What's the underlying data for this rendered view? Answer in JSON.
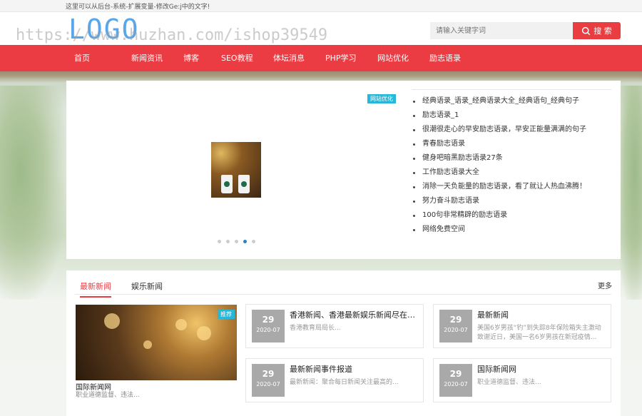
{
  "topbar": {
    "text": "这里可以从后台-系统-扩展变量-修改Ge:j中的文字!"
  },
  "header": {
    "logo": "LOGO",
    "watermark": "https://www.huzhan.com/ishop39549",
    "search": {
      "placeholder": "请输入关键字词",
      "button": "搜 索"
    }
  },
  "nav": {
    "items": [
      "首页",
      "新闻资讯",
      "博客",
      "SEO教程",
      "体坛消息",
      "PHP学习",
      "网站优化",
      "励志语录"
    ]
  },
  "slider": {
    "tag": "网站优化",
    "dots": 5,
    "active_dot": 4
  },
  "headlines": [
    "经典语录_语录_经典语录大全_经典语句_经典句子",
    "励志语录_1",
    "很潮很走心的早安励志语录，早安正能量满满的句子",
    "青春励志语录",
    "健身吧暗黑励志语录27条",
    "工作励志语录大全",
    "消除一天负能量的励志语录，看了就让人热血沸腾！",
    "努力奋斗励志语录",
    "100句非常精辟的励志语录",
    "网络免费空间"
  ],
  "news": {
    "tabs": [
      "最新新闻",
      "娱乐新闻"
    ],
    "more": "更多",
    "featured": {
      "badge": "推荐",
      "title": "国际新闻网",
      "desc": "职业道德监督、违法..."
    },
    "cards": [
      {
        "day": "29",
        "ym": "2020-07",
        "title": "香港新闻、香港最新娱乐新闻尽在香...",
        "summary": "香港教育局局长..."
      },
      {
        "day": "29",
        "ym": "2020-07",
        "title": "最新新闻",
        "summary": "美国6岁男孩“钓”到失踪8年保险箱失主激动致谢近日，美国一名6岁男孩在新冠疫情..."
      },
      {
        "day": "29",
        "ym": "2020-07",
        "title": "最新新闻事件报道",
        "summary": "最新新闻：聚合每日新闻关注最高的..."
      },
      {
        "day": "29",
        "ym": "2020-07",
        "title": "国际新闻网",
        "summary": "职业道德监督、违法..."
      }
    ]
  },
  "colors": {
    "brand_red": "#ea3c42",
    "tag_cyan": "#27b7d8",
    "logo_blue": "#5aa6e8"
  }
}
